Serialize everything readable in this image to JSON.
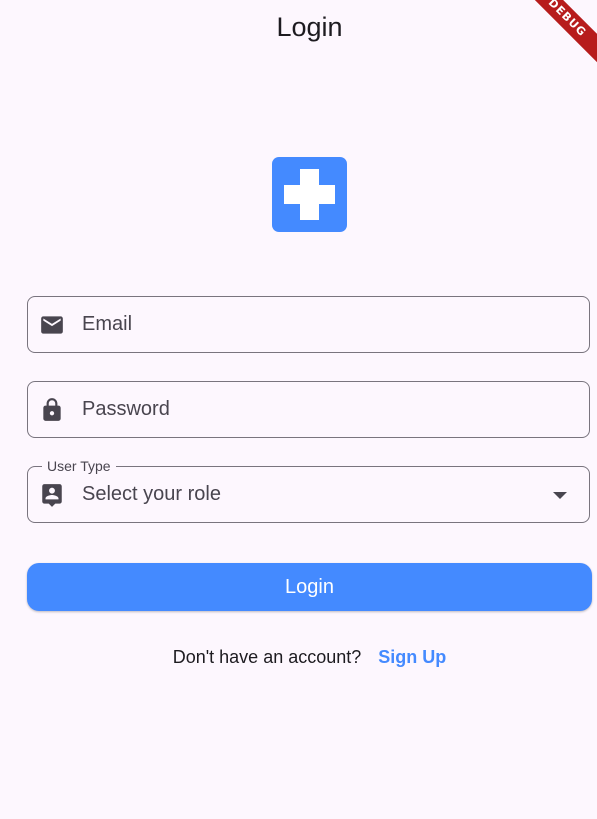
{
  "app_bar": {
    "title": "Login"
  },
  "debug_banner": {
    "label": "DEBUG"
  },
  "logo": {
    "icon": "medical-cross-icon",
    "color": "#448aff"
  },
  "form": {
    "email": {
      "placeholder": "Email",
      "value": "",
      "icon": "mail-icon"
    },
    "password": {
      "placeholder": "Password",
      "value": "",
      "icon": "lock-icon"
    },
    "user_type": {
      "label": "User Type",
      "placeholder": "Select your role",
      "icon": "contact-badge-icon",
      "options": []
    }
  },
  "login_button": {
    "label": "Login"
  },
  "signup": {
    "prompt": "Don't have an account?",
    "link_label": "Sign Up"
  },
  "colors": {
    "background": "#fdf7fe",
    "accent": "#448aff",
    "outline": "#79747e",
    "debug": "#b71c1c"
  }
}
